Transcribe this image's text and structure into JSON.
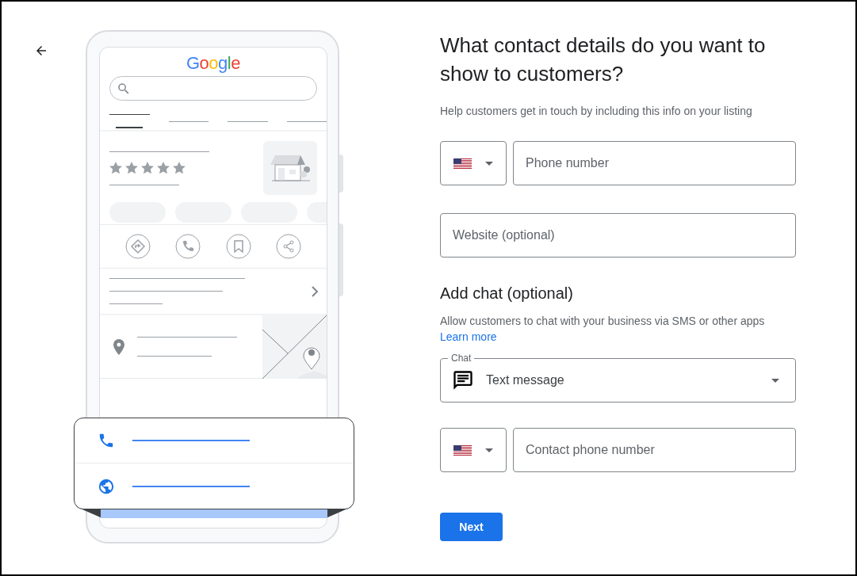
{
  "illustration": {
    "logo": "Google"
  },
  "heading": "What contact details do you want to show to customers?",
  "subheading": "Help customers get in touch by including this info on your listing",
  "phone": {
    "placeholder": "Phone number"
  },
  "website": {
    "placeholder": "Website (optional)"
  },
  "chat_section": {
    "title": "Add chat (optional)",
    "description": "Allow customers to chat with your business via SMS or other apps",
    "link": "Learn more"
  },
  "chat_select": {
    "label": "Chat",
    "value": "Text message"
  },
  "contact_phone": {
    "placeholder": "Contact phone number"
  },
  "next_button": "Next"
}
